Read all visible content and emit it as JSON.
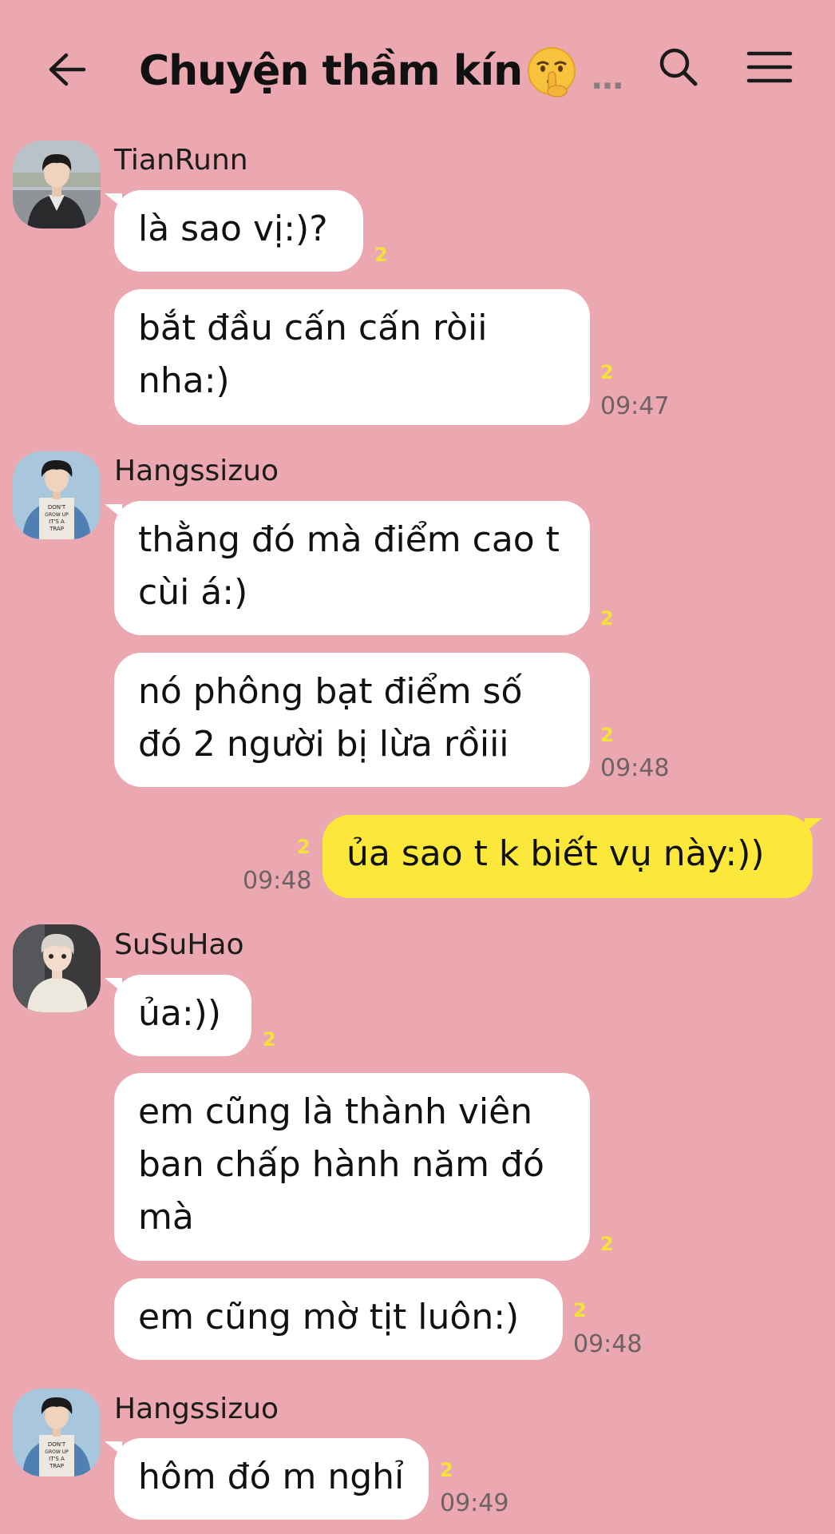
{
  "header": {
    "title": "Chuyện thầm kín",
    "more": "..."
  },
  "messages": [
    {
      "sender": "TianRunn",
      "text": "là sao vị:)?",
      "unread": "2"
    },
    {
      "text": "bắt đầu cấn cấn ròii nha:)",
      "unread": "2",
      "time": "09:47"
    },
    {
      "sender": "Hangssizuo",
      "text": "thằng đó mà điểm cao t cùi á:)",
      "unread": "2"
    },
    {
      "text": "nó phông bạt điểm số đó 2 người bị lừa rồiii",
      "unread": "2",
      "time": "09:48"
    },
    {
      "text": "ủa sao t k biết vụ này:))",
      "unread": "2",
      "time": "09:48",
      "mine": true
    },
    {
      "sender": "SuSuHao",
      "text": "ủa:))",
      "unread": "2"
    },
    {
      "text": "em cũng là thành viên ban chấp hành năm đó mà",
      "unread": "2"
    },
    {
      "text": "em cũng mờ tịt luôn:)",
      "unread": "2",
      "time": "09:48"
    },
    {
      "sender": "Hangssizuo",
      "text": "hôm đó m nghỉ",
      "unread": "2",
      "time": "09:49"
    }
  ],
  "avatar_shirt_text": [
    "DON'T",
    "GROW UP",
    "IT'S A",
    "TRAP"
  ],
  "colors": {
    "background": "#eba8b1",
    "bubble_other": "#ffffff",
    "bubble_mine": "#fbe83b",
    "unread": "#f2e23a"
  }
}
